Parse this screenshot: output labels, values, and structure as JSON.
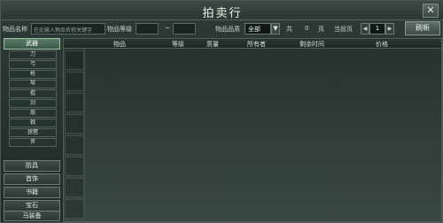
{
  "window": {
    "title": "拍卖行",
    "close_label": "✕"
  },
  "filters": {
    "name_label": "物品名称",
    "name_placeholder": "在此输入物品名称关键字",
    "level_label": "物品等级",
    "level_from": "",
    "dash": "~",
    "level_to": "",
    "quality_label": "物品品质",
    "quality_value": "全部",
    "total_label": "共",
    "total_value": "0",
    "page_unit": "页",
    "current_label": "当前页",
    "prev": "◀",
    "current_page": "1",
    "next": "▶",
    "refresh_label": "刷新"
  },
  "sidebar": {
    "weapons": {
      "label": "武器",
      "items": [
        "刀",
        "弓",
        "枪",
        "琴",
        "棍",
        "剑",
        "扇",
        "戟",
        "琵琶",
        "斧"
      ]
    },
    "categories": [
      "防具",
      "首饰",
      "书籍",
      "宝石",
      "马装备"
    ]
  },
  "table": {
    "columns": [
      "物品",
      "等级",
      "质量",
      "所有者",
      "剩余时间",
      "价格"
    ]
  }
}
